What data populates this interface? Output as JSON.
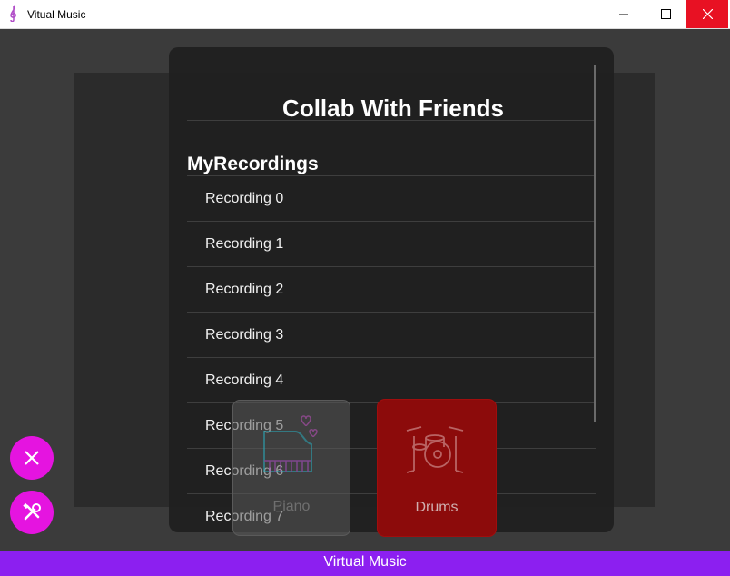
{
  "window": {
    "title": "Vitual Music"
  },
  "dialog": {
    "title": "Collab With Friends",
    "section_title": "MyRecordings",
    "recordings": [
      "Recording 0",
      "Recording 1",
      "Recording 2",
      "Recording 3",
      "Recording 4",
      "Recording 5",
      "Recording 6",
      "Recording 7"
    ]
  },
  "instruments": {
    "piano_label": "Piano",
    "drums_label": "Drums"
  },
  "footer": {
    "label": "Virtual Music"
  },
  "colors": {
    "accent": "#e514e0",
    "footer": "#8c1ff0",
    "close": "#e81123"
  },
  "icons": [
    "treble-clef-icon",
    "minimize-icon",
    "maximize-icon",
    "close-icon",
    "piano-icon",
    "drums-icon",
    "fab-close-icon",
    "tools-icon"
  ]
}
